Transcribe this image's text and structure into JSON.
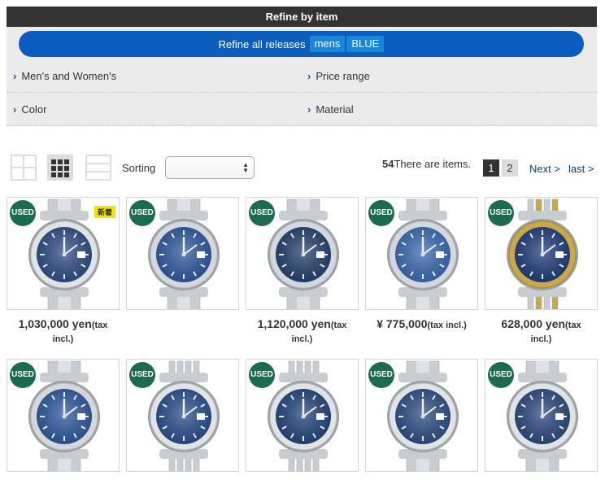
{
  "refine": {
    "title": "Refine by item",
    "release_label": "Refine all releases",
    "chips": [
      "mens",
      "BLUE"
    ],
    "filters": [
      "Men's and Women's",
      "Price range",
      "Color",
      "Material"
    ]
  },
  "toolbar": {
    "sort_label": "Sorting",
    "sort_value": "",
    "count_number": "54",
    "count_text": "There are items.",
    "pages": [
      "1",
      "2"
    ],
    "next_label": "Next >",
    "last_label": "last >"
  },
  "products": [
    {
      "badge": "USED",
      "new_badge": "新着",
      "dial": "#2e4e86",
      "bezel": "fluted",
      "bracelet": "oyster",
      "price_main": "1,030,000 yen",
      "price_suffix": "(tax",
      "price_line2": "incl.)"
    },
    {
      "badge": "USED",
      "dial": "#2f5aa0",
      "bezel": "smooth",
      "bracelet": "oyster",
      "price_main": "",
      "price_suffix": "",
      "price_line2": ""
    },
    {
      "badge": "USED",
      "dial": "#24416f",
      "bezel": "smooth",
      "bracelet": "oyster",
      "price_main": "1,120,000 yen",
      "price_suffix": "(tax",
      "price_line2": "incl.)"
    },
    {
      "badge": "USED",
      "dial": "#3a6cb3",
      "bezel": "smooth",
      "bracelet": "oyster",
      "price_main": "¥ 775,000",
      "price_suffix": "(tax incl.)",
      "price_line2": ""
    },
    {
      "badge": "USED",
      "dial": "#1f3e7a",
      "bezel": "gold",
      "bracelet": "jubilee-gold",
      "price_main": "628,000 yen",
      "price_suffix": "(tax",
      "price_line2": "incl.)"
    },
    {
      "badge": "USED",
      "dial": "#2f5aa0",
      "bezel": "smooth",
      "bracelet": "oyster"
    },
    {
      "badge": "USED",
      "dial": "#2a4f8f",
      "bezel": "fluted",
      "bracelet": "jubilee"
    },
    {
      "badge": "USED",
      "dial": "#23457d",
      "bezel": "fluted",
      "bracelet": "jubilee"
    },
    {
      "badge": "USED",
      "dial": "#2d4f85",
      "bezel": "fluted",
      "bracelet": "oyster"
    },
    {
      "badge": "USED",
      "dial": "#2b4a80",
      "bezel": "fluted",
      "bracelet": "oyster"
    }
  ],
  "colors": {
    "accent": "#0b5dbf",
    "chip": "#1a85d9",
    "header": "#333333",
    "used_badge": "#1b6b4f"
  }
}
